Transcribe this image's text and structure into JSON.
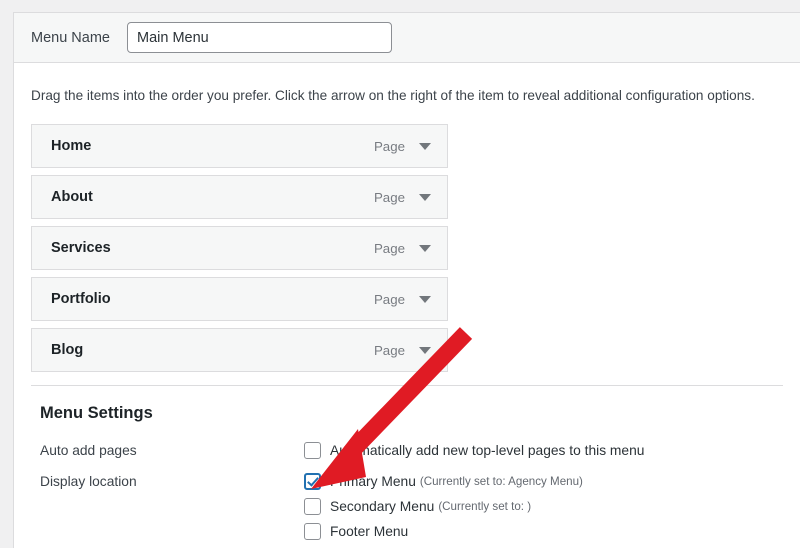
{
  "menu_name": {
    "label": "Menu Name",
    "value": "Main Menu",
    "placeholder": "Enter menu name here"
  },
  "instructions": "Drag the items into the order you prefer. Click the arrow on the right of the item to reveal additional configuration options.",
  "menu_items": [
    {
      "title": "Home",
      "type": "Page"
    },
    {
      "title": "About",
      "type": "Page"
    },
    {
      "title": "Services",
      "type": "Page"
    },
    {
      "title": "Portfolio",
      "type": "Page"
    },
    {
      "title": "Blog",
      "type": "Page"
    }
  ],
  "menu_settings": {
    "heading": "Menu Settings",
    "auto_add": {
      "label": "Auto add pages",
      "checkbox_label": "Automatically add new top-level pages to this menu",
      "checked": false
    },
    "display_location": {
      "label": "Display location",
      "options": [
        {
          "label": "Primary Menu",
          "note": "(Currently set to: Agency Menu)",
          "checked": true
        },
        {
          "label": "Secondary Menu",
          "note": "(Currently set to: )",
          "checked": false
        },
        {
          "label": "Footer Menu",
          "note": "",
          "checked": false
        }
      ]
    }
  },
  "annotation": {
    "arrow_color": "#e01b24",
    "points_to": "Primary Menu checkbox"
  },
  "colors": {
    "accent": "#2271b1",
    "panel_bg": "#ffffff",
    "page_bg": "#f0f0f1",
    "row_bg": "#f6f7f7",
    "border": "#dcdcde"
  }
}
